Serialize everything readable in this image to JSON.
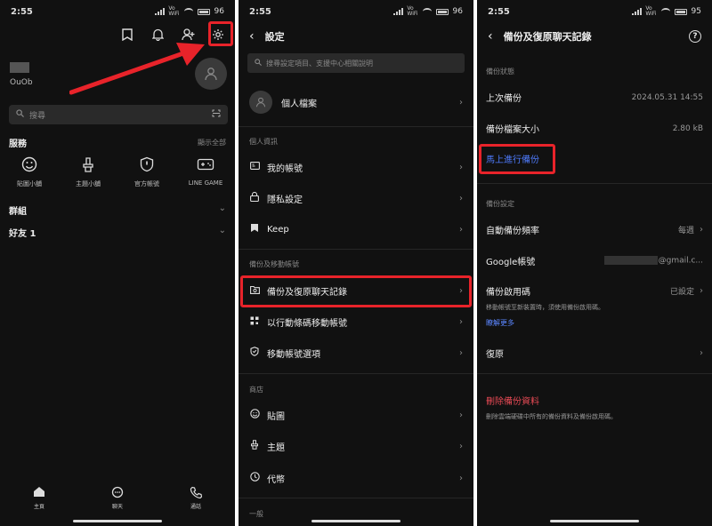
{
  "status": {
    "p1_time": "2:55",
    "p1_battery": "96",
    "p2_time": "2:55",
    "p2_battery": "96",
    "p3_time": "2:55",
    "p3_battery": "95",
    "vo_label": "Vo",
    "wifi_label": "WiFi"
  },
  "home": {
    "profile_sub": "OuOb",
    "search_placeholder": "搜尋",
    "services_title": "服務",
    "services_more": "顯示全部",
    "services": [
      {
        "label": "貼圖小舖",
        "icon": "smiley-icon"
      },
      {
        "label": "主題小舖",
        "icon": "brush-icon"
      },
      {
        "label": "官方帳號",
        "icon": "shield-icon"
      },
      {
        "label": "LINE GAME",
        "icon": "gamepad-icon"
      }
    ],
    "groups_title": "群組",
    "friends_title": "好友 1",
    "nav": [
      {
        "label": "主頁",
        "icon": "home-icon"
      },
      {
        "label": "聊天",
        "icon": "chat-icon"
      },
      {
        "label": "通話",
        "icon": "phone-icon"
      }
    ]
  },
  "settings": {
    "title": "設定",
    "search_placeholder": "搜尋設定項目、支援中心相關說明",
    "profile_label": "個人檔案",
    "group_personal": "個人資訊",
    "my_account": "我的帳號",
    "privacy": "隱私設定",
    "keep": "Keep",
    "group_backup": "備份及移動帳號",
    "backup_restore": "備份及復原聊天記錄",
    "move_qr": "以行動條碼移動帳號",
    "move_options": "移動帳號選項",
    "group_store": "商店",
    "stickers": "貼圖",
    "themes": "主題",
    "coins": "代幣",
    "group_general": "一般"
  },
  "backup": {
    "title": "備份及復原聊天記錄",
    "section_status": "備份狀態",
    "last_backup_label": "上次備份",
    "last_backup_value": "2024.05.31 14:55",
    "size_label": "備份檔案大小",
    "size_value": "2.80 kB",
    "backup_now": "馬上進行備份",
    "section_settings": "備份設定",
    "auto_freq_label": "自動備份頻率",
    "auto_freq_value": "每週",
    "google_label": "Google帳號",
    "google_value": "@gmail.c...",
    "pin_label": "備份啟用碼",
    "pin_value": "已設定",
    "pin_note": "移動帳號至新裝置時，須使用備份啟用碼。",
    "learn_more": "瞭解更多",
    "restore_label": "復原",
    "delete_label": "刪除備份資料",
    "delete_note": "刪除雲端硬碟中所有的備份資料及備份啟用碼。"
  }
}
